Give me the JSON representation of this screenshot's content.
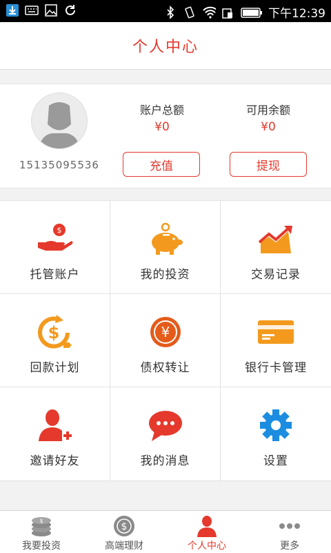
{
  "status_bar": {
    "time": "下午12:39"
  },
  "header": {
    "title": "个人中心"
  },
  "account": {
    "phone": "15135095536",
    "total_label": "账户总额",
    "total_value": "¥0",
    "available_label": "可用余额",
    "available_value": "¥0",
    "recharge_label": "充值",
    "withdraw_label": "提现"
  },
  "menu": [
    {
      "label": "托管账户",
      "icon": "hand-money-icon"
    },
    {
      "label": "我的投资",
      "icon": "piggy-bank-icon"
    },
    {
      "label": "交易记录",
      "icon": "trend-chart-icon"
    },
    {
      "label": "回款计划",
      "icon": "dollar-return-icon"
    },
    {
      "label": "债权转让",
      "icon": "yuan-transfer-icon"
    },
    {
      "label": "银行卡管理",
      "icon": "bank-card-icon"
    },
    {
      "label": "邀请好友",
      "icon": "add-user-icon"
    },
    {
      "label": "我的消息",
      "icon": "message-bubble-icon"
    },
    {
      "label": "设置",
      "icon": "gear-icon"
    }
  ],
  "tabs": [
    {
      "label": "我要投资",
      "icon": "coin-stack-icon"
    },
    {
      "label": "高端理财",
      "icon": "dollar-circle-icon"
    },
    {
      "label": "个人中心",
      "icon": "person-icon",
      "active": true
    },
    {
      "label": "更多",
      "icon": "more-dots-icon"
    }
  ],
  "colors": {
    "accent": "#e4392c",
    "orange": "#f39a1e"
  }
}
